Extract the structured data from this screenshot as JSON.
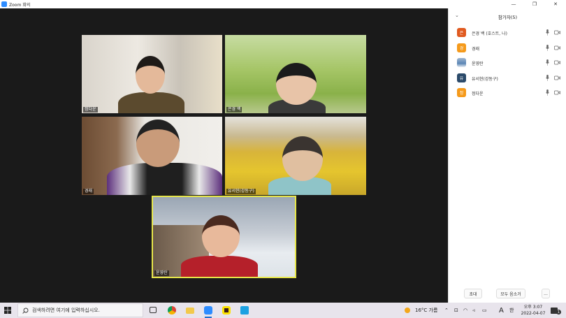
{
  "window": {
    "title": "Zoom 회의"
  },
  "tiles": [
    {
      "name": "정다운"
    },
    {
      "name": "은경 백"
    },
    {
      "name": "경래"
    },
    {
      "name": "유서현(강동구)"
    },
    {
      "name": "윤영란"
    }
  ],
  "panel": {
    "title": "참가자(5)",
    "participants": [
      {
        "avatar": "은",
        "avatar_color": "#e05a1f",
        "name": "은경 백 (호스트, 나)"
      },
      {
        "avatar": "경",
        "avatar_color": "#f59a1b",
        "name": "경래"
      },
      {
        "avatar": "",
        "avatar_color": "#5b86b5",
        "name": "윤영란"
      },
      {
        "avatar": "유",
        "avatar_color": "#2b4a6a",
        "name": "유서현(강동구)"
      },
      {
        "avatar": "정",
        "avatar_color": "#f59a1b",
        "name": "정다운"
      }
    ],
    "invite_label": "초대",
    "mute_all_label": "모두 음소거",
    "more_label": "..."
  },
  "taskbar": {
    "search_placeholder": "검색하려면 여기에 입력하십시오.",
    "weather": "16°C 가름",
    "ime": "A",
    "lang": "한",
    "time": "오후 3:07",
    "date": "2022-04-07",
    "notifications": "1"
  },
  "colors": {
    "accent": "#2d8cff",
    "active_speaker": "#e6e64a"
  }
}
